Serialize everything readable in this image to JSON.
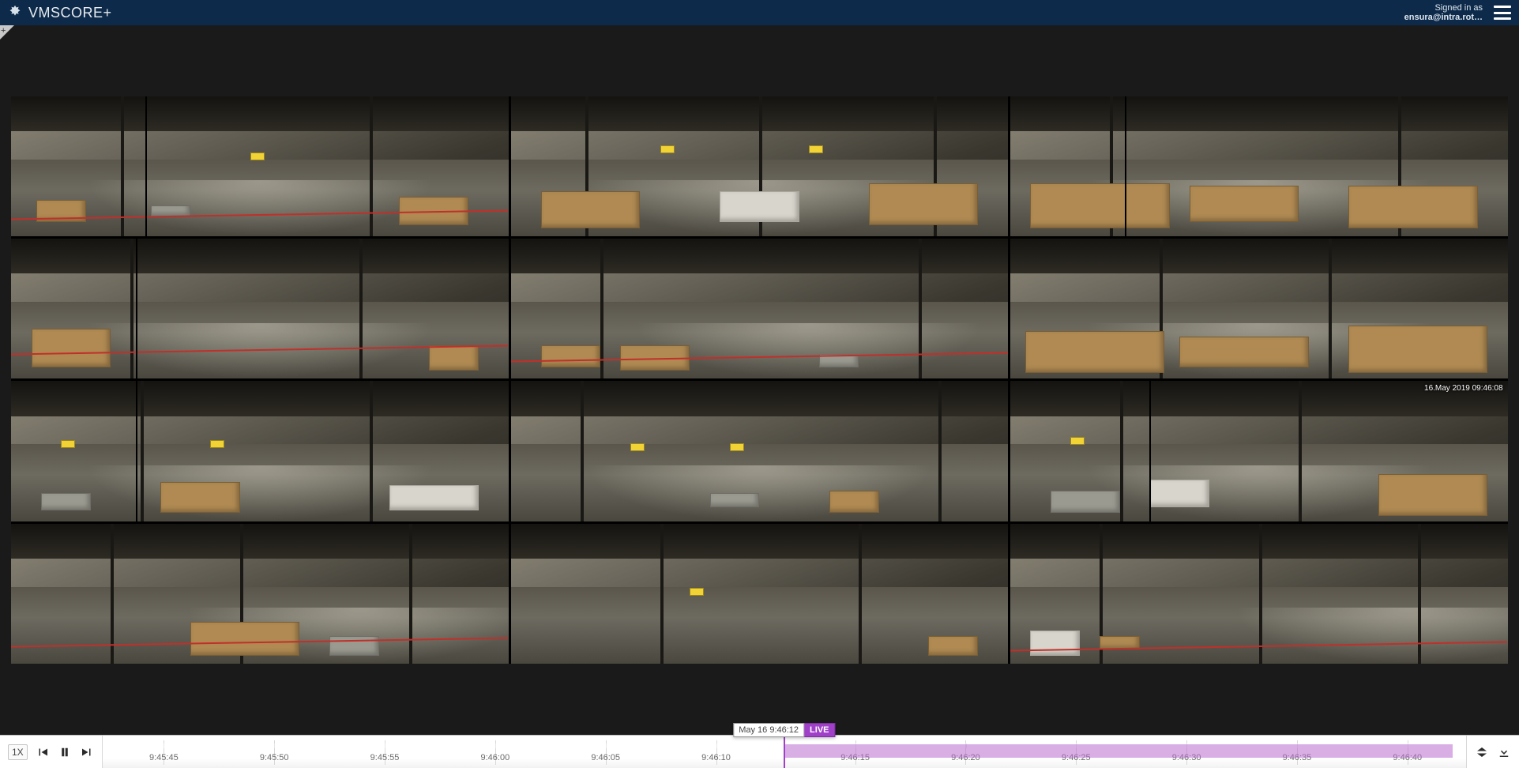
{
  "app": {
    "title": "VMSCORE+"
  },
  "header": {
    "signed_in_label": "Signed in as",
    "username": "ensura@intra.rot…"
  },
  "grid": {
    "rows": 4,
    "cols": 3,
    "overlay_timestamp": "16.May 2019   09:46:08"
  },
  "playback": {
    "speed_label": "1X"
  },
  "playhead": {
    "datetime_label": "May 16 9:46:12",
    "live_label": "LIVE",
    "position_pct": 50.0
  },
  "timeline": {
    "live_region_start_pct": 50.0,
    "live_region_end_pct": 99.0,
    "ticks": [
      {
        "label": "9:45:45",
        "pct": 4.5
      },
      {
        "label": "9:45:50",
        "pct": 12.6
      },
      {
        "label": "9:45:55",
        "pct": 20.7
      },
      {
        "label": "9:46:00",
        "pct": 28.8
      },
      {
        "label": "9:46:05",
        "pct": 36.9
      },
      {
        "label": "9:46:10",
        "pct": 45.0
      },
      {
        "label": "9:46:15",
        "pct": 55.2
      },
      {
        "label": "9:46:20",
        "pct": 63.3
      },
      {
        "label": "9:46:25",
        "pct": 71.4
      },
      {
        "label": "9:46:30",
        "pct": 79.5
      },
      {
        "label": "9:46:35",
        "pct": 87.6
      },
      {
        "label": "9:46:40",
        "pct": 95.7
      }
    ]
  }
}
